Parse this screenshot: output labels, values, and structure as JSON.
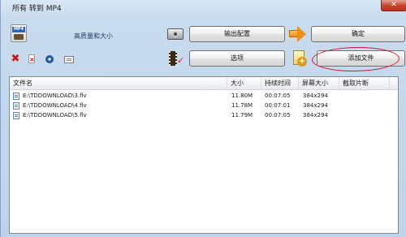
{
  "window": {
    "title": "所有 转到 MP4",
    "close_glyph": "✕"
  },
  "toolbar": {
    "quality_label": "高质量和大小",
    "quality_icon_text": "MP4",
    "output_config_label": "输出配置",
    "options_label": "选项",
    "ok_label": "确定",
    "add_file_label": "添加文件",
    "delete_glyph": "✖"
  },
  "file_list": {
    "columns": [
      "文件名",
      "大小",
      "持续时间",
      "屏幕大小",
      "截取片断"
    ],
    "rows": [
      {
        "name": "E:\\TDDOWNLOAD\\3.flv",
        "size": "11.80M",
        "duration": "00:07:05",
        "resolution": "384x294",
        "clip": ""
      },
      {
        "name": "E:\\TDDOWNLOAD\\4.flv",
        "size": "11.78M",
        "duration": "00:07:01",
        "resolution": "384x294",
        "clip": ""
      },
      {
        "name": "E:\\TDDOWNLOAD\\5.flv",
        "size": "11.79M",
        "duration": "00:07:05",
        "resolution": "384x294",
        "clip": ""
      }
    ]
  },
  "colors": {
    "highlight_circle": "#d8152a",
    "arrow_orange": "#ec8f16"
  }
}
